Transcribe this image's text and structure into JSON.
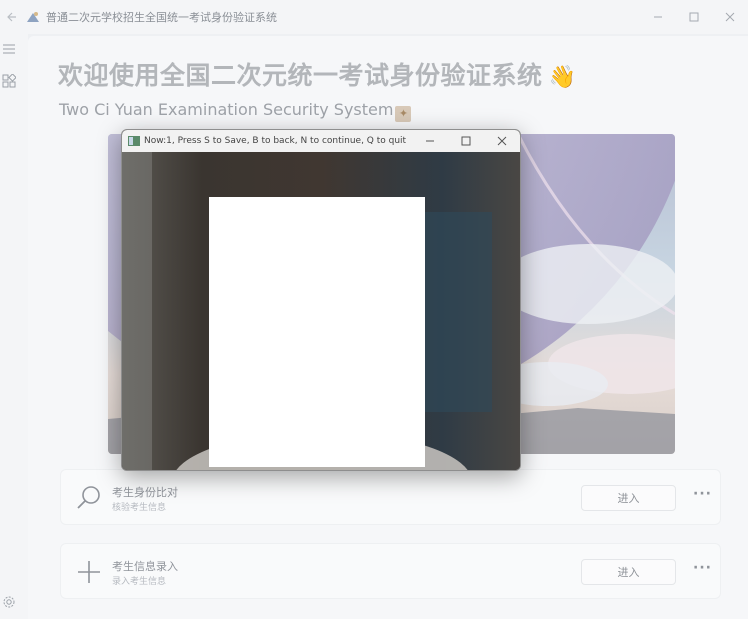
{
  "window": {
    "title": "普通二次元学校招生全国统一考试身份验证系统",
    "controls": [
      "minimize",
      "maximize",
      "close"
    ]
  },
  "main": {
    "heading": "欢迎使用全国二次元统一考试身份验证系统",
    "heading_emoji": "👋",
    "subtitle": "Two Ci Yuan Examination Security System"
  },
  "cards": [
    {
      "title": "考生身份比对",
      "subtitle": "核验考生信息",
      "button": "进入",
      "more": "···",
      "icon": "search-icon"
    },
    {
      "title": "考生信息录入",
      "subtitle": "录入考生信息",
      "button": "进入",
      "more": "···",
      "icon": "plus-icon"
    }
  ],
  "camera_window": {
    "title": "Now:1, Press S to Save, B to back, N to continue, Q to quit"
  },
  "colors": {
    "accent": "#e0b26a",
    "window_bg": "#f6f7f9",
    "camera_bg": "#2a2622"
  }
}
